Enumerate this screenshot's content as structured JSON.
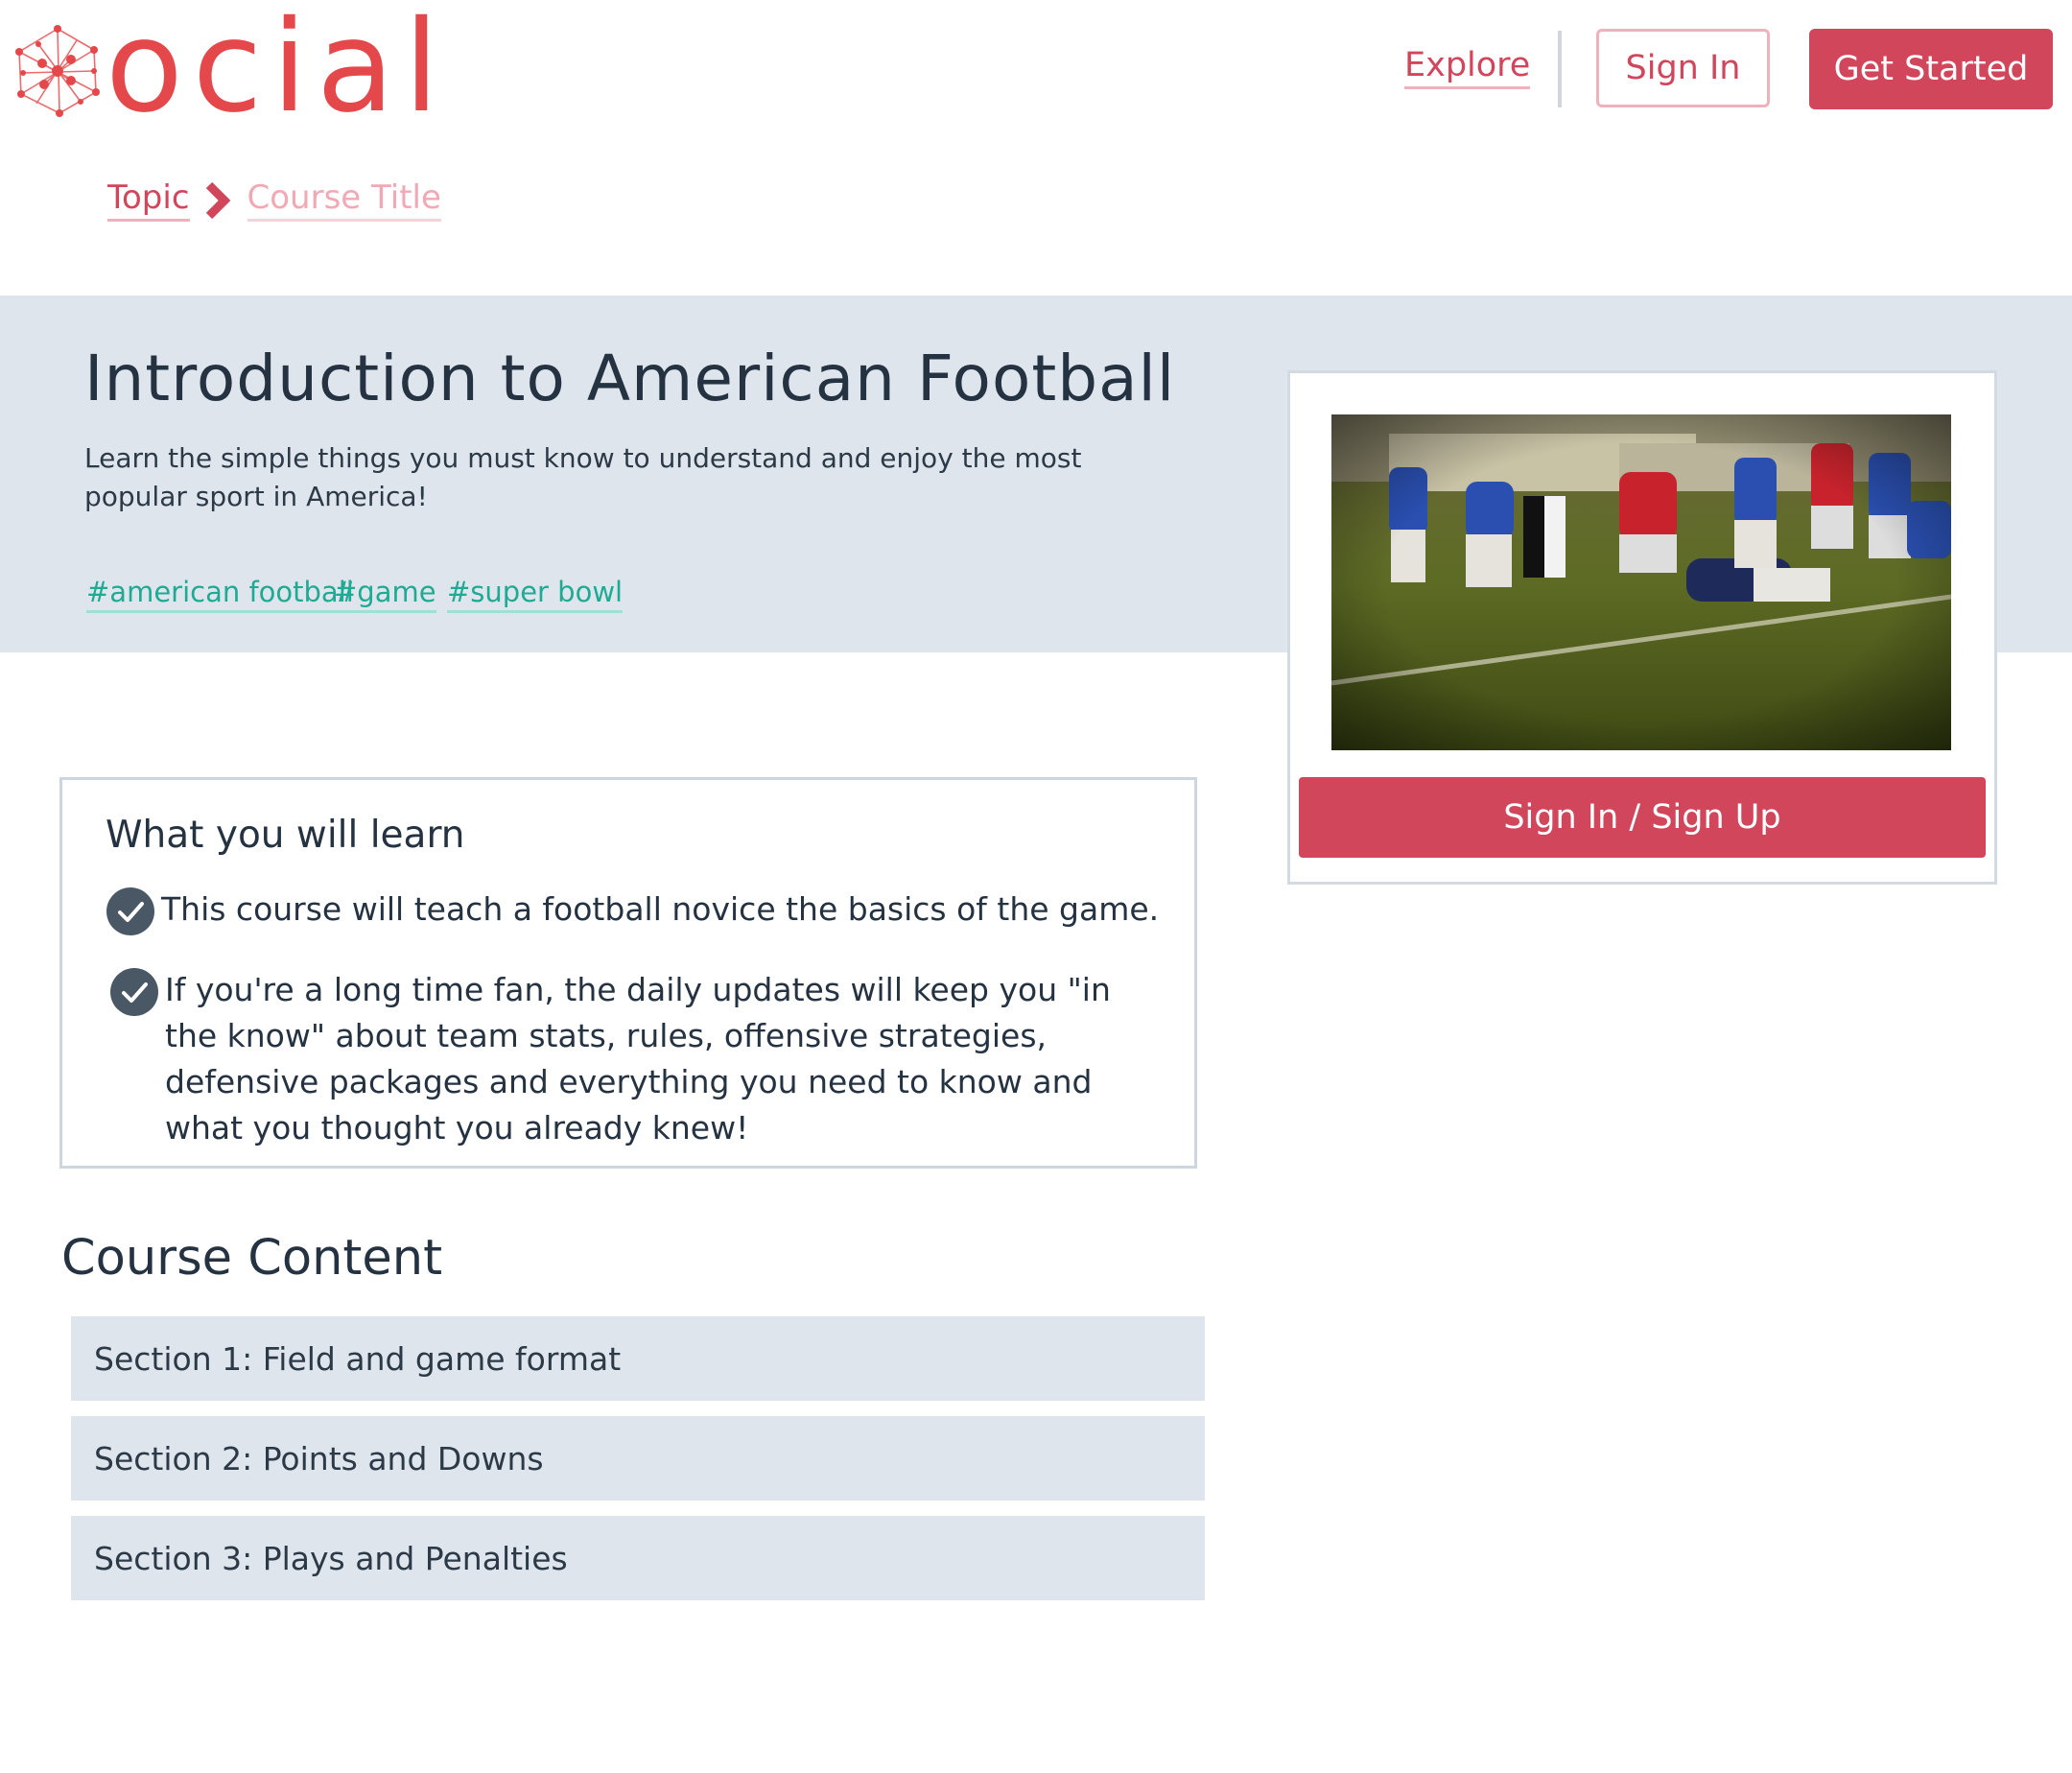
{
  "header": {
    "logo_text": "ocial",
    "nav": {
      "explore": "Explore",
      "sign_in": "Sign In",
      "get_started": "Get Started"
    }
  },
  "breadcrumb": {
    "topic": "Topic",
    "current": "Course Title"
  },
  "course": {
    "title": "Introduction to American Football",
    "description": "Learn the simple things you must know to understand and enjoy the most popular sport in America!",
    "tags": [
      "#american football",
      "#game",
      "#super bowl"
    ]
  },
  "card": {
    "cta": "Sign In / Sign Up"
  },
  "learn": {
    "title": "What you will learn",
    "items": [
      "This course will teach a football novice the basics of the game.",
      "If you're a long time fan, the daily updates will keep you \"in the know\" about team stats, rules, offensive strategies, defensive packages and everything you need to know and what you thought you already knew!"
    ]
  },
  "content": {
    "title": "Course Content",
    "sections": [
      "Section 1: Field and game format",
      "Section 2: Points and Downs",
      "Section 3: Plays and Penalties"
    ]
  },
  "colors": {
    "brand": "#e5484b",
    "accent": "#d2465c",
    "tag": "#1faa94",
    "band": "#dfe5ec",
    "check": "#4a5866"
  }
}
